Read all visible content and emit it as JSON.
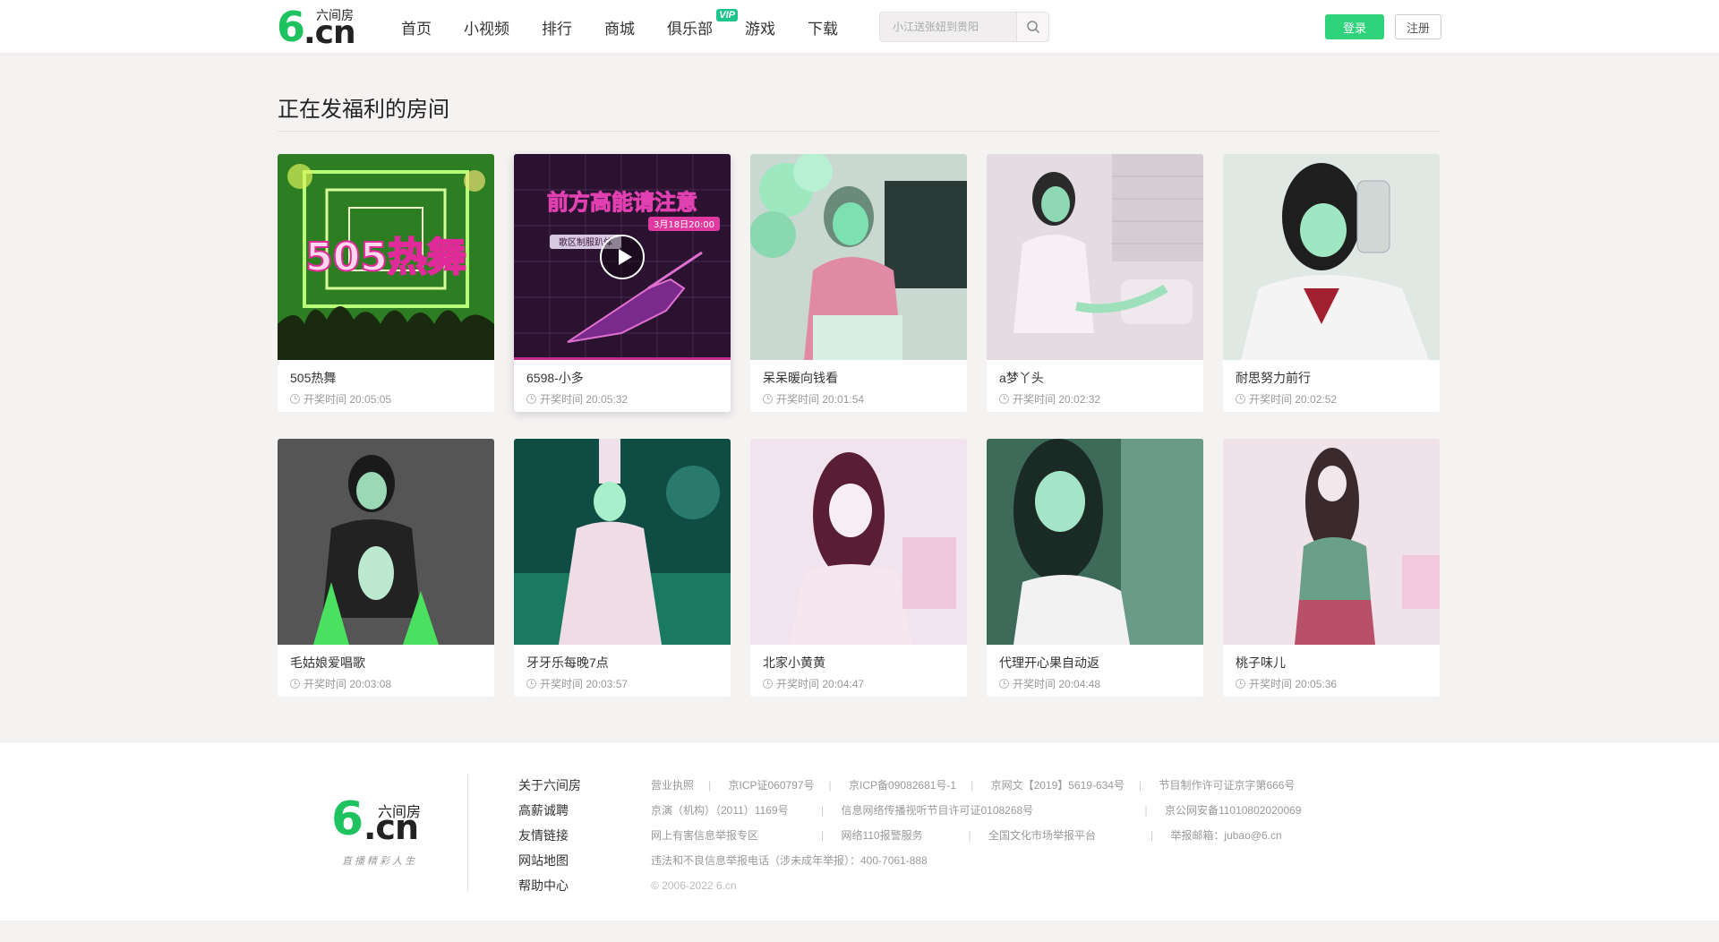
{
  "header": {
    "logo_text": "六间房",
    "logo_mark": "6",
    "logo_domain": ".cn",
    "nav": [
      "首页",
      "小视频",
      "排行",
      "商城",
      "俱乐部",
      "游戏",
      "下载"
    ],
    "vip_badge": "VIP",
    "search_placeholder": "小江送张妞到贵阳",
    "login": "登录",
    "register": "注册"
  },
  "section": {
    "title": "正在发福利的房间"
  },
  "rooms": [
    {
      "name": "505热舞",
      "time_label": "开奖时间",
      "time": "20:05:05",
      "poster_text": "505热舞",
      "colors": [
        "#2c7a1c",
        "#c7f26a"
      ]
    },
    {
      "name": "6598-小多",
      "time_label": "开奖时间",
      "time": "20:05:32",
      "poster_text": "前方高能请注意",
      "poster_sub": "3月18日20:00",
      "poster_sub2": "歌区制服趴体",
      "colors": [
        "#2a1030",
        "#8a2a7a"
      ]
    },
    {
      "name": "呆呆暖向钱看",
      "time_label": "开奖时间",
      "time": "20:01:54",
      "colors": [
        "#6a8a78",
        "#cfeadc"
      ]
    },
    {
      "name": "a梦丫头",
      "time_label": "开奖时间",
      "time": "20:02:32",
      "colors": [
        "#d9c8d0",
        "#eae0e6"
      ]
    },
    {
      "name": "耐思努力前行",
      "time_label": "开奖时间",
      "time": "20:02:52",
      "colors": [
        "#c8d8d0",
        "#e6eeea"
      ]
    },
    {
      "name": "毛姑娘爱唱歌",
      "time_label": "开奖时间",
      "time": "20:03:08",
      "colors": [
        "#4a4a4a",
        "#6b6b6b"
      ]
    },
    {
      "name": "牙牙乐每晚7点",
      "time_label": "开奖时间",
      "time": "20:03:57",
      "colors": [
        "#0a4a44",
        "#2a8a7a"
      ]
    },
    {
      "name": "北家小黄黄",
      "time_label": "开奖时间",
      "time": "20:04:47",
      "colors": [
        "#e8cfe0",
        "#f6e8f0"
      ]
    },
    {
      "name": "代理开心果自动返",
      "time_label": "开奖时间",
      "time": "20:04:48",
      "colors": [
        "#3a6a58",
        "#9ad8c0"
      ]
    },
    {
      "name": "桃子味儿",
      "time_label": "开奖时间",
      "time": "20:05:36",
      "colors": [
        "#e6d0dc",
        "#f6e6ee"
      ]
    }
  ],
  "footer": {
    "logo_text": "六间房",
    "logo_mark": "6",
    "logo_domain": ".cn",
    "slogan": "直播精彩人生",
    "links": [
      "关于六间房",
      "高薪诚聘",
      "友情链接",
      "网站地图",
      "帮助中心"
    ],
    "info_rows": [
      [
        "营业执照",
        "京ICP证060797号",
        "京ICP备09082681号-1",
        "京网文【2019】5619-634号",
        "节目制作许可证京字第666号"
      ],
      [
        "京演（机构）（2011）1169号",
        "信息网络传播视听节目许可证0108268号",
        "京公网安备11010802020069"
      ],
      [
        "网上有害信息举报专区",
        "网络110报警服务",
        "全国文化市场举报平台",
        "举报邮箱：jubao@6.cn"
      ],
      [
        "违法和不良信息举报电话（涉未成年举报）：400-7061-888"
      ]
    ],
    "copyright": "© 2006-2022 6.cn"
  }
}
